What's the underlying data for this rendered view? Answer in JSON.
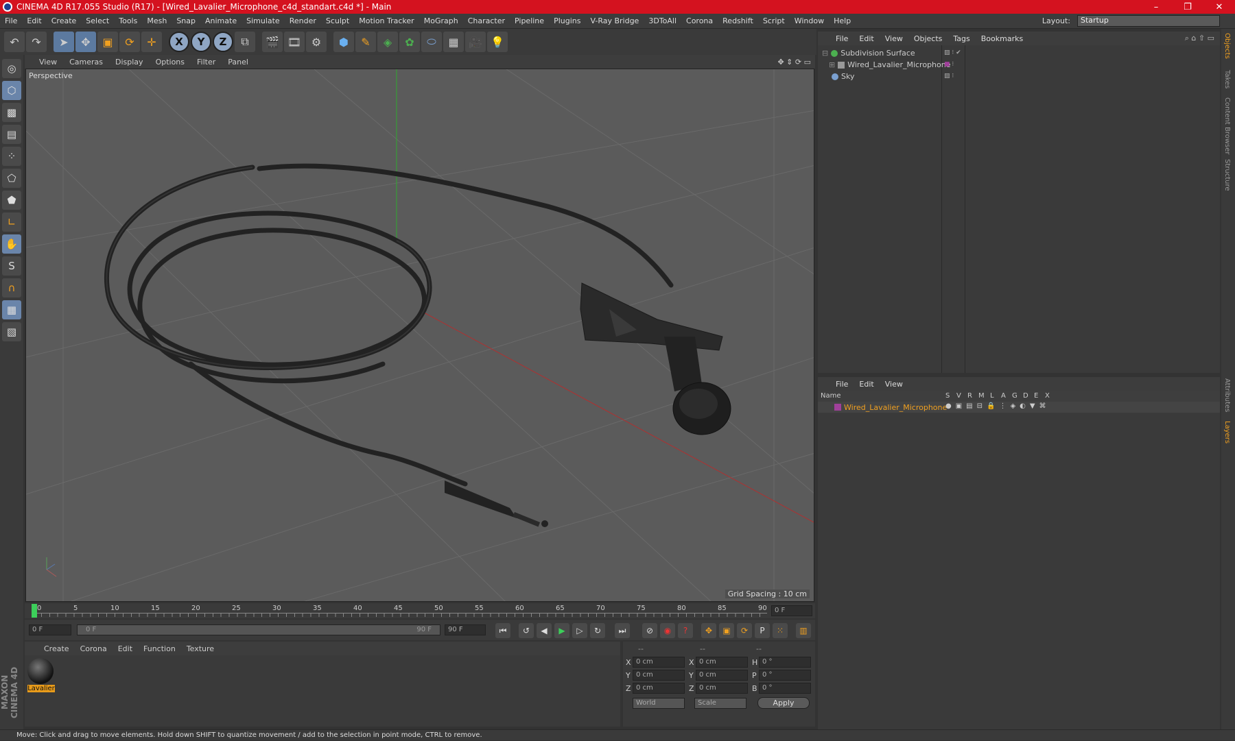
{
  "window": {
    "title": "CINEMA 4D R17.055 Studio (R17) - [Wired_Lavalier_Microphone_c4d_standart.c4d *] - Main",
    "minimize": "–",
    "maximize": "❐",
    "close": "✕"
  },
  "menu": [
    "File",
    "Edit",
    "Create",
    "Select",
    "Tools",
    "Mesh",
    "Snap",
    "Animate",
    "Simulate",
    "Render",
    "Sculpt",
    "Motion Tracker",
    "MoGraph",
    "Character",
    "Pipeline",
    "Plugins",
    "V-Ray Bridge",
    "3DToAll",
    "Corona",
    "Redshift",
    "Script",
    "Window",
    "Help"
  ],
  "layout": {
    "label": "Layout:",
    "value": "Startup"
  },
  "toolbar": {
    "x": "X",
    "y": "Y",
    "z": "Z"
  },
  "viewport": {
    "menu": [
      "View",
      "Cameras",
      "Display",
      "Options",
      "Filter",
      "Panel"
    ],
    "label": "Perspective",
    "grid_spacing": "Grid Spacing : 10 cm"
  },
  "timeline": {
    "ticks": [
      "0",
      "5",
      "10",
      "15",
      "20",
      "25",
      "30",
      "35",
      "40",
      "45",
      "50",
      "55",
      "60",
      "65",
      "70",
      "75",
      "80",
      "85",
      "90"
    ],
    "current": "0 F"
  },
  "transport": {
    "start": "0 F",
    "range_start": "0 F",
    "range_end": "90 F",
    "end": "90 F"
  },
  "materials": {
    "menu": [
      "Create",
      "Corona",
      "Edit",
      "Function",
      "Texture"
    ],
    "items": [
      {
        "name": "Lavalier"
      }
    ]
  },
  "coords": {
    "headers": [
      "--",
      "--",
      "--"
    ],
    "rows": [
      {
        "a": "X",
        "av": "0 cm",
        "b": "X",
        "bv": "0 cm",
        "c": "H",
        "cv": "0 °"
      },
      {
        "a": "Y",
        "av": "0 cm",
        "b": "Y",
        "bv": "0 cm",
        "c": "P",
        "cv": "0 °"
      },
      {
        "a": "Z",
        "av": "0 cm",
        "b": "Z",
        "bv": "0 cm",
        "c": "B",
        "cv": "0 °"
      }
    ],
    "world": "World",
    "scale": "Scale",
    "apply": "Apply"
  },
  "objects": {
    "menu": [
      "File",
      "Edit",
      "View",
      "Objects",
      "Tags",
      "Bookmarks"
    ],
    "items": [
      {
        "name": "Subdivision Surface",
        "color": "#4caf50"
      },
      {
        "name": "Wired_Lavalier_Microphone",
        "color": "#a0a0a0"
      },
      {
        "name": "Sky",
        "color": "#7aa0d0"
      }
    ]
  },
  "layers": {
    "menu": [
      "File",
      "Edit",
      "View"
    ],
    "columns": [
      "Name",
      "S",
      "V",
      "R",
      "M",
      "L",
      "A",
      "G",
      "D",
      "E",
      "X"
    ],
    "items": [
      {
        "name": "Wired_Lavalier_Microphone",
        "color": "#a0409a"
      }
    ]
  },
  "right_tabs": [
    "Objects",
    "Takes",
    "Content Browser",
    "Structure",
    "Attributes",
    "Layers"
  ],
  "branding": "MAXON CINEMA 4D",
  "status": "Move: Click and drag to move elements. Hold down SHIFT to quantize movement / add to the selection in point mode, CTRL to remove."
}
